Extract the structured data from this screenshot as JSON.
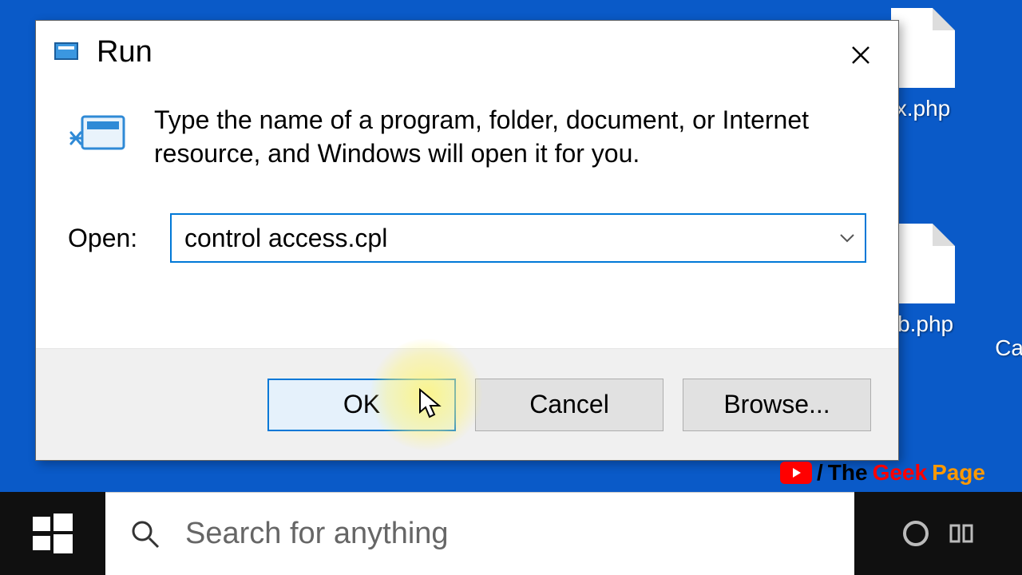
{
  "desktop": {
    "icons": [
      {
        "label": "x.php"
      },
      {
        "label": "lb.php"
      }
    ],
    "rightCut": "Ca"
  },
  "dialog": {
    "title": "Run",
    "description": "Type the name of a program, folder, document, or Internet resource, and Windows will open it for you.",
    "openLabel": "Open:",
    "command": "control access.cpl",
    "buttons": {
      "ok": "OK",
      "cancel": "Cancel",
      "browse": "Browse..."
    }
  },
  "taskbar": {
    "searchPlaceholder": "Search for anything"
  },
  "watermark": {
    "slash": "/",
    "the": "The",
    "geek": "Geek",
    "page": "Page"
  }
}
